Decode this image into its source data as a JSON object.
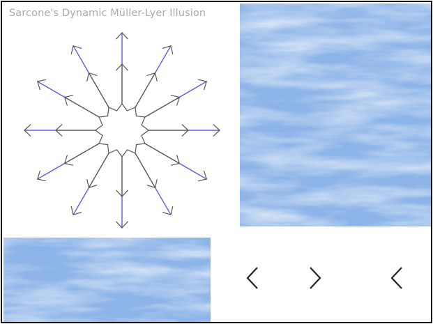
{
  "title": "Sarcone's Dynamic Müller-Lyer Illusion",
  "illustration": {
    "type": "dynamic-muller-lyer-star",
    "arms": 12,
    "colors": {
      "gray_line": "#555555",
      "blue_line": "#5a5ae0"
    }
  },
  "background_texture": {
    "name": "sky-clouds",
    "color": "#8db4e8"
  },
  "controls": [
    {
      "name": "previous-icon",
      "glyph": "chevron-left"
    },
    {
      "name": "next-icon",
      "glyph": "chevron-right"
    },
    {
      "name": "previous-icon",
      "glyph": "chevron-left"
    }
  ]
}
